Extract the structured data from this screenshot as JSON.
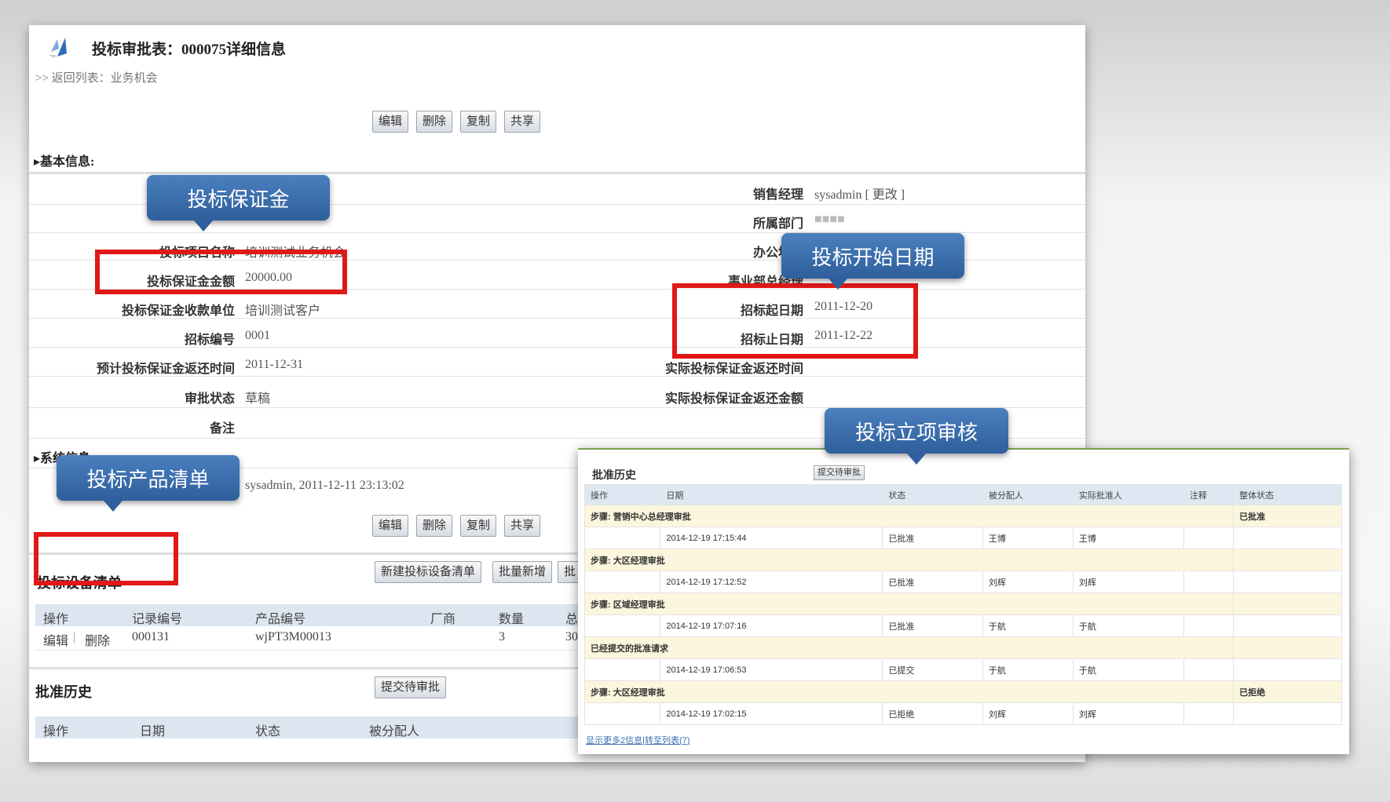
{
  "header": {
    "title": "投标审批表：000075详细信息",
    "breadcrumb": ">> 返回列表：业务机会"
  },
  "toolbar": {
    "edit": "编辑",
    "delete": "删除",
    "copy": "复制",
    "share": "共享"
  },
  "basic_info": {
    "section_title": "▸基本信息:",
    "left": [
      {
        "label": "投标项目名称",
        "value": "培训测试业务机会"
      },
      {
        "label": "投标保证金金额",
        "value": "20000.00"
      },
      {
        "label": "投标保证金收款单位",
        "value": "培训测试客户"
      },
      {
        "label": "招标编号",
        "value": "0001"
      },
      {
        "label": "预计投标保证金返还时间",
        "value": "2011-12-31"
      },
      {
        "label": "审批状态",
        "value": "草稿"
      },
      {
        "label": "备注",
        "value": ""
      }
    ],
    "right": [
      {
        "label": "销售经理",
        "value": "sysadmin [ 更改 ]"
      },
      {
        "label": "所属部门",
        "value": "■■■■"
      },
      {
        "label": "办公地点",
        "value": ""
      },
      {
        "label": "事业部总经理",
        "value": ""
      },
      {
        "label": "招标起日期",
        "value": "2011-12-20"
      },
      {
        "label": "招标止日期",
        "value": "2011-12-22"
      },
      {
        "label": "实际投标保证金返还时间",
        "value": ""
      },
      {
        "label": "实际投标保证金返还金额",
        "value": ""
      }
    ]
  },
  "system_info": {
    "section_title": "▸系统信息:",
    "created": "sysadmin, 2011-12-11 23:13:02"
  },
  "equipment": {
    "title": "投标设备清单",
    "new_button": "新建投标设备清单",
    "batch_button": "批量新增",
    "cut_button": "批",
    "columns": [
      "操作",
      "记录编号",
      "产品编号",
      "厂商",
      "数量",
      "总"
    ],
    "row": {
      "edit": "编辑",
      "sep": "|",
      "delete": "删除",
      "record": "000131",
      "product": "wjPT3M00013",
      "vendor": "",
      "qty": "3",
      "extra": "30"
    }
  },
  "history_bg": {
    "title": "批准历史",
    "submit": "提交待审批",
    "columns": [
      "操作",
      "日期",
      "状态",
      "被分配人"
    ]
  },
  "callouts": {
    "deposit": "投标保证金",
    "start_date": "投标开始日期",
    "product_list": "投标产品清单",
    "approval": "投标立项审核"
  },
  "approval_panel": {
    "title": "批准历史",
    "submit": "提交待审批",
    "columns": [
      "操作",
      "日期",
      "状态",
      "被分配人",
      "实际批准人",
      "注释",
      "整体状态"
    ],
    "groups": [
      {
        "step": "步骤: 营销中心总经理审批",
        "overall": "已批准",
        "date": "2014-12-19 17:15:44",
        "status": "已批准",
        "assignee": "王博",
        "actual": "王博"
      },
      {
        "step": "步骤: 大区经理审批",
        "overall": "",
        "date": "2014-12-19 17:12:52",
        "status": "已批准",
        "assignee": "刘辉",
        "actual": "刘辉"
      },
      {
        "step": "步骤: 区域经理审批",
        "overall": "",
        "date": "2014-12-19 17:07:16",
        "status": "已批准",
        "assignee": "于航",
        "actual": "于航"
      },
      {
        "step": "已经提交的批准请求",
        "overall": "",
        "date": "2014-12-19 17:06:53",
        "status": "已提交",
        "assignee": "于航",
        "actual": "于航"
      },
      {
        "step": "步骤: 大区经理审批",
        "overall": "已拒绝",
        "date": "2014-12-19 17:02:15",
        "status": "已拒绝",
        "assignee": "刘辉",
        "actual": "刘辉"
      }
    ],
    "footer_more": "显示更多2信息",
    "footer_sep": "|",
    "footer_list": "转至列表(7)"
  }
}
